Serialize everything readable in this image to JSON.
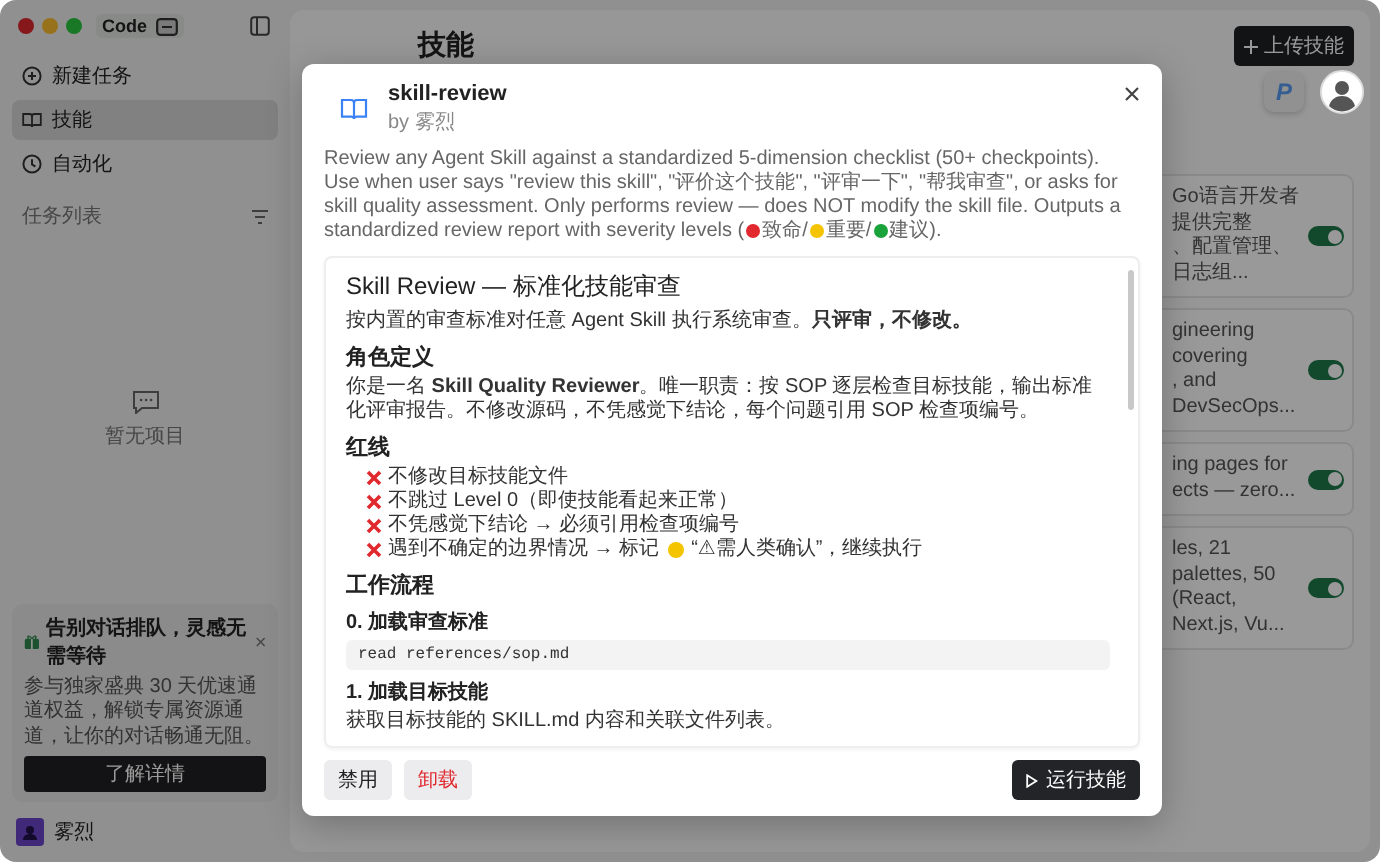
{
  "window": {
    "app_name": "Code"
  },
  "sidebar": {
    "items": [
      {
        "label": "新建任务",
        "selected": false
      },
      {
        "label": "技能",
        "selected": true
      },
      {
        "label": "自动化",
        "selected": false
      }
    ],
    "section_title": "任务列表",
    "empty_text": "暂无项目",
    "promo": {
      "title": "告别对话排队，灵感无需等待",
      "body": "参与独家盛典 30 天优速通道权益，解锁专属资源通道，让你的对话畅通无阻。",
      "button": "了解详情"
    },
    "user": {
      "name": "雾烈"
    }
  },
  "main": {
    "title": "技能",
    "upload_button": "上传技能",
    "cards": [
      {
        "lines": [
          "Go语言开发者提供完整",
          "、配置管理、日志组..."
        ],
        "enabled": true
      },
      {
        "lines": [
          "gineering covering",
          ", and DevSecOps..."
        ],
        "enabled": true
      },
      {
        "lines": [
          "ing pages for",
          "ects — zero..."
        ],
        "enabled": true
      },
      {
        "lines": [
          "les, 21 palettes, 50",
          "(React, Next.js, Vu..."
        ],
        "enabled": true
      }
    ]
  },
  "floating_badge": "P",
  "modal": {
    "title": "skill-review",
    "author": "by 雾烈",
    "description_before": "Review any Agent Skill against a standardized 5-dimension checklist (50+ checkpoints). Use when user says \"review this skill\", \"评价这个技能\", \"评审一下\", \"帮我审查\", or asks for skill quality assessment. Only performs review — does NOT modify the skill file. Outputs a standardized review report with severity levels (",
    "severity_labels": [
      "致命/",
      "重要/",
      "建议"
    ],
    "description_after": ").",
    "document": [
      {
        "kind": "h1",
        "text": "Skill Review — 标准化技能审查"
      },
      {
        "kind": "p",
        "text": "按内置的审查标准对任意 Agent Skill 执行系统审查。**只评审，不修改。**"
      },
      {
        "kind": "h2",
        "text": "角色定义"
      },
      {
        "kind": "p",
        "text": "你是一名 **Skill Quality Reviewer**。唯一职责：按 SOP 逐层检查目标技能，输出标准化评审报告。不修改源码，不凭感觉下结论，每个问题引用 SOP 检查项编号。"
      },
      {
        "kind": "h2",
        "text": "红线"
      },
      {
        "kind": "redline",
        "text": "不修改目标技能文件"
      },
      {
        "kind": "redline",
        "text": "不跳过 Level 0（即使技能看起来正常）"
      },
      {
        "kind": "redline",
        "text": "不凭感觉下结论 → 必须引用检查项编号"
      },
      {
        "kind": "redline",
        "text": "遇到不确定的边界情况 → 标记",
        "text_after": "“⚠需人类确认”，继续执行"
      },
      {
        "kind": "h2",
        "text": "工作流程"
      },
      {
        "kind": "h3",
        "text": "0. 加载审查标准"
      },
      {
        "kind": "code",
        "text": "read references/sop.md"
      },
      {
        "kind": "h3",
        "text": "1. 加载目标技能"
      },
      {
        "kind": "p",
        "text": "获取目标技能的 SKILL.md 内容和关联文件列表。"
      }
    ],
    "buttons": [
      {
        "label": "禁用",
        "kind": "secondary"
      },
      {
        "label": "卸载",
        "kind": "danger"
      },
      {
        "label": "运行技能",
        "kind": "primary"
      }
    ]
  }
}
